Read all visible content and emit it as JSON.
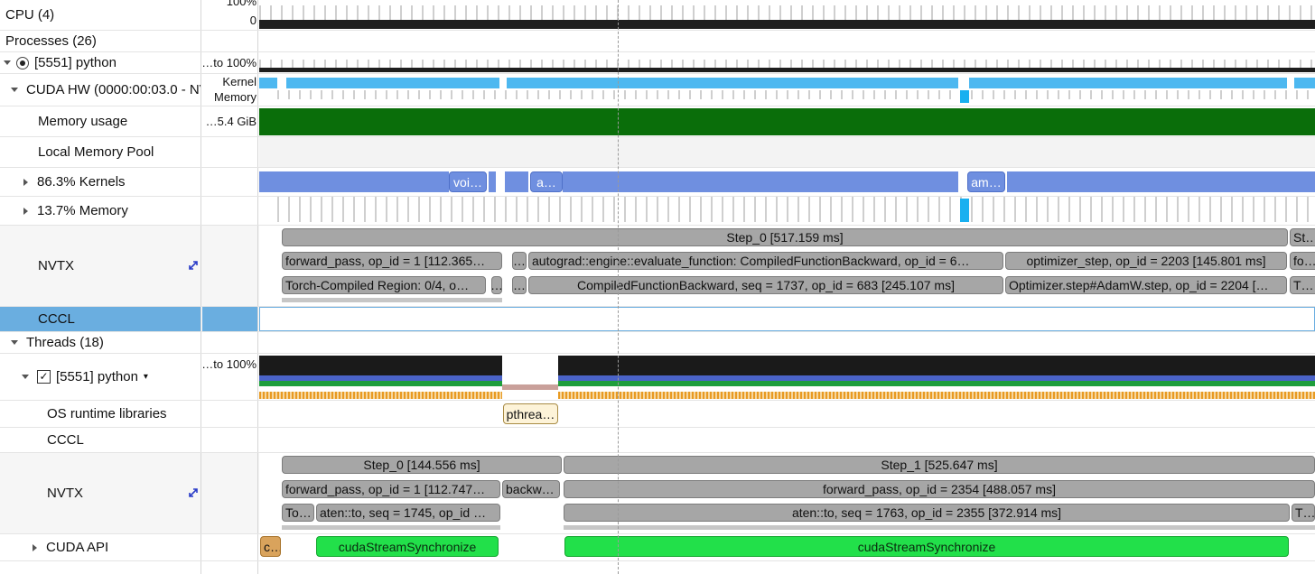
{
  "rows": {
    "cpu": {
      "label": "CPU (4)",
      "scale_top": "100%",
      "scale_bottom": "0"
    },
    "processes": {
      "label": "Processes (26)"
    },
    "python_proc": {
      "label": "[5551] python",
      "scale": "…to 100%"
    },
    "cuda_hw": {
      "label": "CUDA HW (0000:00:03.0 - NV",
      "scale_kernel": "Kernel",
      "scale_memory": "Memory"
    },
    "memory_usage": {
      "label": "Memory usage",
      "scale": "…5.4 GiB"
    },
    "local_memory_pool": {
      "label": "Local Memory Pool"
    },
    "kernels": {
      "label": "86.3% Kernels",
      "boxes": [
        "voi…",
        "a…",
        "am…"
      ]
    },
    "memory": {
      "label": "13.7% Memory"
    },
    "nvtx_gpu": {
      "label": "NVTX",
      "l1": [
        "Step_0 [517.159 ms]",
        "St…"
      ],
      "l2": [
        "forward_pass, op_id = 1 [112.365…",
        "…",
        "autograd::engine::evaluate_function: CompiledFunctionBackward, op_id = 6…",
        "optimizer_step, op_id = 2203 [145.801 ms]",
        "fo…"
      ],
      "l3": [
        "Torch-Compiled Region: 0/4, o…",
        "…",
        "…",
        "CompiledFunctionBackward, seq = 1737, op_id = 683 [245.107 ms]",
        "Optimizer.step#AdamW.step, op_id = 2204 […",
        "T…"
      ]
    },
    "cccl_gpu": {
      "label": "CCCL"
    },
    "threads": {
      "label": "Threads (18)"
    },
    "python_thread": {
      "label": "[5551] python",
      "scale": "…to 100%",
      "check": "✓"
    },
    "os_runtime": {
      "label": "OS runtime libraries",
      "box": "pthrea…"
    },
    "cccl_thread": {
      "label": "CCCL"
    },
    "nvtx_thread": {
      "label": "NVTX",
      "l1": [
        "Step_0 [144.556 ms]",
        "Step_1 [525.647 ms]"
      ],
      "l2": [
        "forward_pass, op_id = 1 [112.747…",
        "backw…",
        "forward_pass, op_id = 2354 [488.057 ms]"
      ],
      "l3": [
        "To…",
        "aten::to, seq = 1745, op_id …",
        "aten::to, seq = 1763, op_id = 2355 [372.914 ms]",
        "T…"
      ]
    },
    "cuda_api": {
      "label": "CUDA API",
      "boxes": [
        "c…",
        "cudaStreamSynchronize",
        "cudaStreamSynchronize"
      ]
    }
  },
  "colors": {
    "selected_row": "#6aaee0",
    "memory_usage": "#0a6e0a",
    "kernel_cyan": "#4db8f0",
    "kernel_blue": "#6f8fe0",
    "cuda_api_green": "#22e04a"
  }
}
